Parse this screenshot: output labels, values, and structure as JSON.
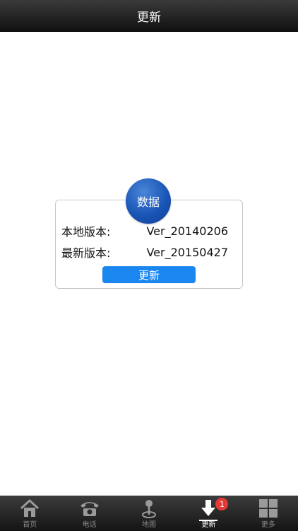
{
  "header": {
    "title": "更新"
  },
  "card": {
    "badge_text": "数据",
    "rows": [
      {
        "label": "本地版本:",
        "value": "Ver_20140206"
      },
      {
        "label": "最新版本:",
        "value": "Ver_20150427"
      }
    ],
    "button_label": "更新"
  },
  "tabbar": {
    "tabs": [
      {
        "label": "首页",
        "icon": "home-icon"
      },
      {
        "label": "电话",
        "icon": "phone-icon"
      },
      {
        "label": "地图",
        "icon": "map-pin-icon"
      },
      {
        "label": "更新",
        "icon": "download-icon",
        "badge": "1",
        "active": true
      },
      {
        "label": "更多",
        "icon": "grid-icon"
      }
    ]
  },
  "colors": {
    "accent": "#1a86f0",
    "badge_red": "#e53935",
    "circle_blue": "#1a56b6"
  }
}
